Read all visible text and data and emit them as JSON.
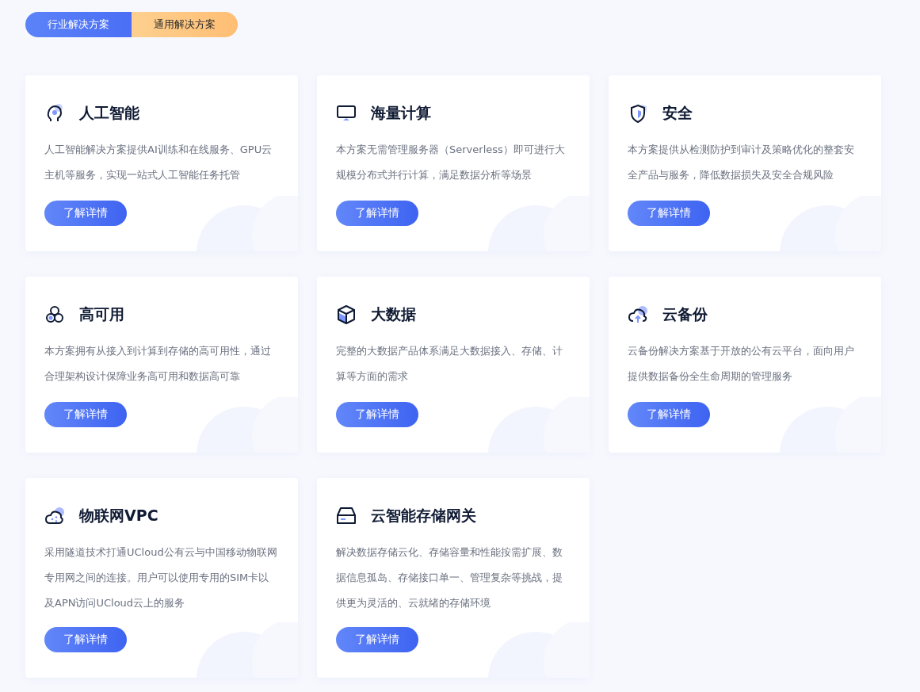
{
  "tabs": [
    {
      "label": "行业解决方案",
      "selected": true
    },
    {
      "label": "通用解决方案",
      "selected": false
    }
  ],
  "cards": [
    {
      "title": "人工智能",
      "description": "人工智能解决方案提供AI训练和在线服务、GPU云主机等服务，实现一站式人工智能任务托管",
      "button": "了解详情"
    },
    {
      "title": "海量计算",
      "description": "本方案无需管理服务器（Serverless）即可进行大规模分布式并行计算，满足数据分析等场景",
      "button": "了解详情"
    },
    {
      "title": "安全",
      "description": "本方案提供从检测防护到审计及策略优化的整套安全产品与服务，降低数据损失及安全合规风险",
      "button": "了解详情"
    },
    {
      "title": "高可用",
      "description": "本方案拥有从接入到计算到存储的高可用性，通过合理架构设计保障业务高可用和数据高可靠",
      "button": "了解详情"
    },
    {
      "title": "大数据",
      "description": "完整的大数据产品体系满足大数据接入、存储、计算等方面的需求",
      "button": "了解详情"
    },
    {
      "title": "云备份",
      "description": "云备份解决方案基于开放的公有云平台，面向用户提供数据备份全生命周期的管理服务",
      "button": "了解详情"
    },
    {
      "title": "物联网VPC",
      "description": "采用隧道技术打通UCloud公有云与中国移动物联网专用网之间的连接。用户可以使用专用的SIM卡以及APN访问UCloud云上的服务",
      "button": "了解详情"
    },
    {
      "title": "云智能存储网关",
      "description": "解决数据存储云化、存储容量和性能按需扩展、数据信息孤岛、存储接口单一、管理复杂等挑战，提供更为灵活的、云就绪的存储环境",
      "button": "了解详情"
    }
  ]
}
